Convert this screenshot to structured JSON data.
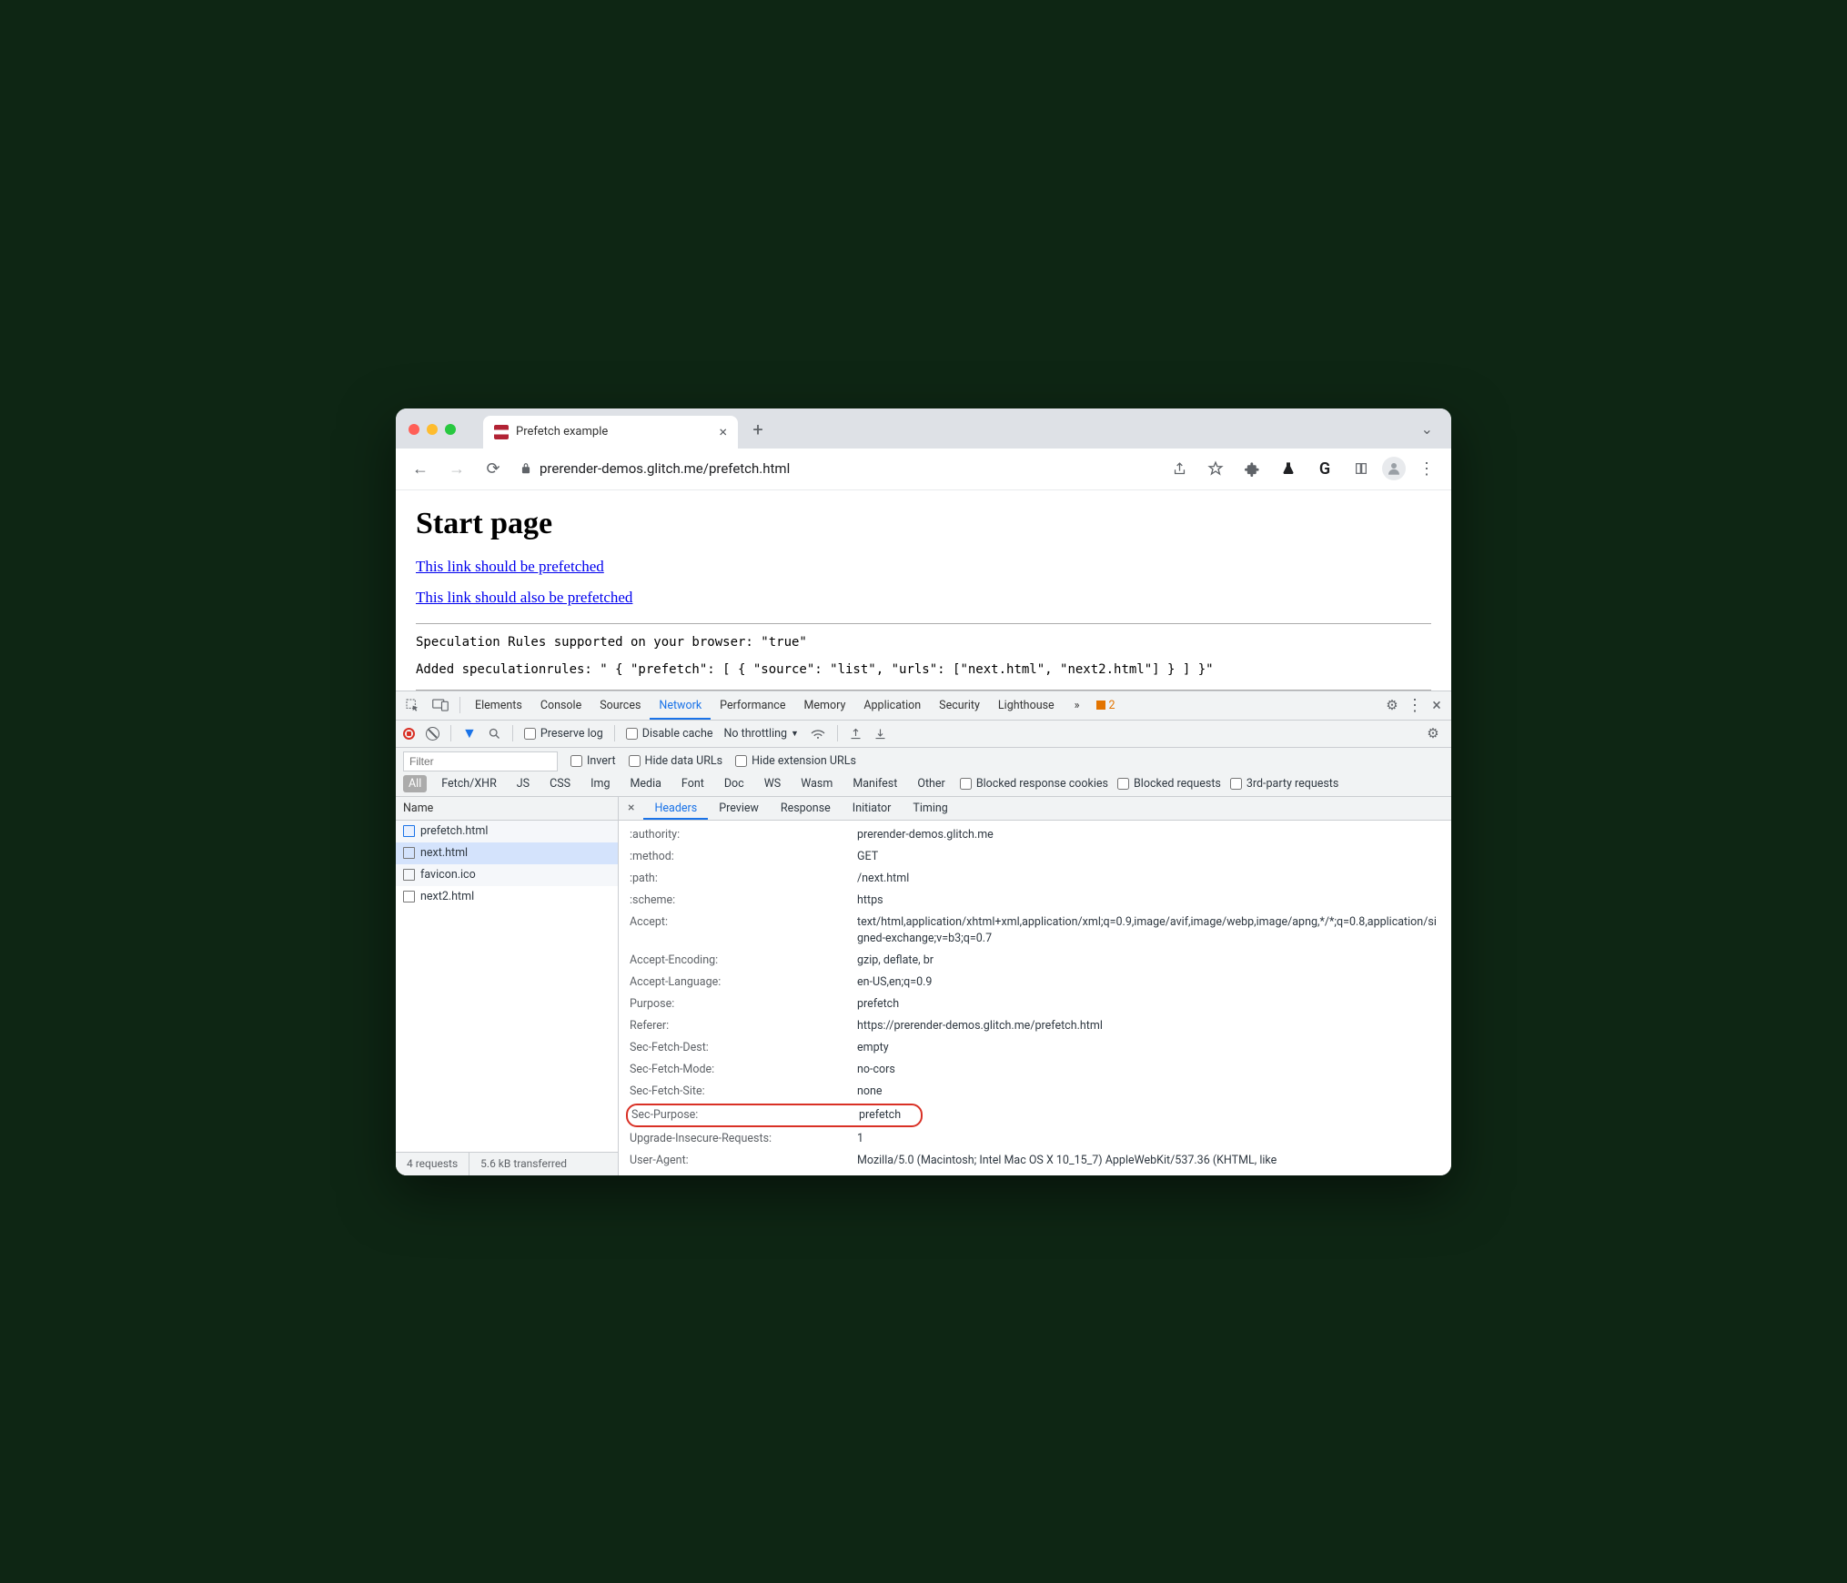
{
  "browser": {
    "tab_title": "Prefetch example",
    "url": "prerender-demos.glitch.me/prefetch.html"
  },
  "page": {
    "heading": "Start page",
    "link1": "This link should be prefetched",
    "link2": "This link should also be prefetched",
    "status1": "Speculation Rules supported on your browser: \"true\"",
    "status2": "Added speculationrules: \" { \"prefetch\": [ { \"source\": \"list\", \"urls\": [\"next.html\", \"next2.html\"] } ] }\""
  },
  "devtools": {
    "panels": [
      "Elements",
      "Console",
      "Sources",
      "Network",
      "Performance",
      "Memory",
      "Application",
      "Security",
      "Lighthouse"
    ],
    "active_panel": "Network",
    "warn_count": "2",
    "toolbar": {
      "preserve": "Preserve log",
      "disable_cache": "Disable cache",
      "throttling": "No throttling"
    },
    "filters": {
      "placeholder": "Filter",
      "invert": "Invert",
      "hide_data": "Hide data URLs",
      "hide_ext": "Hide extension URLs",
      "types": [
        "All",
        "Fetch/XHR",
        "JS",
        "CSS",
        "Img",
        "Media",
        "Font",
        "Doc",
        "WS",
        "Wasm",
        "Manifest",
        "Other"
      ],
      "active_type": "All",
      "blocked_cookies": "Blocked response cookies",
      "blocked_req": "Blocked requests",
      "third_party": "3rd-party requests"
    },
    "name_col": "Name",
    "requests": [
      "prefetch.html",
      "next.html",
      "favicon.ico",
      "next2.html"
    ],
    "selected_request": "next.html",
    "detail_tabs": [
      "Headers",
      "Preview",
      "Response",
      "Initiator",
      "Timing"
    ],
    "active_detail": "Headers",
    "headers": [
      {
        "name": ":authority:",
        "value": "prerender-demos.glitch.me"
      },
      {
        "name": ":method:",
        "value": "GET"
      },
      {
        "name": ":path:",
        "value": "/next.html"
      },
      {
        "name": ":scheme:",
        "value": "https"
      },
      {
        "name": "Accept:",
        "value": "text/html,application/xhtml+xml,application/xml;q=0.9,image/avif,image/webp,image/apng,*/*;q=0.8,application/signed-exchange;v=b3;q=0.7"
      },
      {
        "name": "Accept-Encoding:",
        "value": "gzip, deflate, br"
      },
      {
        "name": "Accept-Language:",
        "value": "en-US,en;q=0.9"
      },
      {
        "name": "Purpose:",
        "value": "prefetch"
      },
      {
        "name": "Referer:",
        "value": "https://prerender-demos.glitch.me/prefetch.html"
      },
      {
        "name": "Sec-Fetch-Dest:",
        "value": "empty"
      },
      {
        "name": "Sec-Fetch-Mode:",
        "value": "no-cors"
      },
      {
        "name": "Sec-Fetch-Site:",
        "value": "none"
      },
      {
        "name": "Sec-Purpose:",
        "value": "prefetch",
        "highlight": true
      },
      {
        "name": "Upgrade-Insecure-Requests:",
        "value": "1"
      },
      {
        "name": "User-Agent:",
        "value": "Mozilla/5.0 (Macintosh; Intel Mac OS X 10_15_7) AppleWebKit/537.36 (KHTML, like"
      }
    ],
    "status": {
      "requests": "4 requests",
      "transferred": "5.6 kB transferred"
    }
  }
}
